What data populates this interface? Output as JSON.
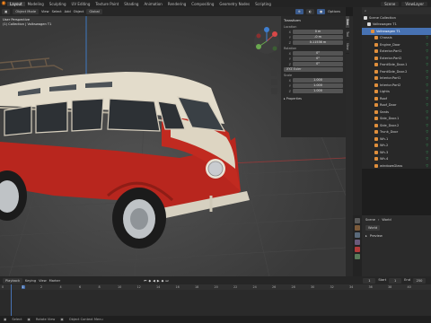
{
  "topbar": {
    "workspaces": [
      "Layout",
      "Modeling",
      "Sculpting",
      "UV Editing",
      "Texture Paint",
      "Shading",
      "Animation",
      "Rendering",
      "Compositing",
      "Geometry Nodes",
      "Scripting"
    ],
    "active_workspace": "Layout",
    "scene": "Scene",
    "view_layer": "ViewLayer"
  },
  "viewport_header": {
    "mode": "Object Mode",
    "view": "View",
    "select": "Select",
    "add": "Add",
    "object": "Object",
    "orientation": "Global",
    "options": "Options"
  },
  "viewport_info": {
    "line1": "User Perspective",
    "line2": "(1) Collection | Volkswagen T1"
  },
  "npanel": {
    "title": "Transform",
    "location_label": "Location",
    "location": [
      {
        "axis": "X",
        "value": "0 m"
      },
      {
        "axis": "Y",
        "value": "-0 m"
      },
      {
        "axis": "Z",
        "value": "0.11536 m"
      }
    ],
    "rotation_label": "Rotation",
    "rotation": [
      {
        "axis": "X",
        "value": "0°"
      },
      {
        "axis": "Y",
        "value": "0°"
      },
      {
        "axis": "Z",
        "value": "0°"
      }
    ],
    "rotation_mode": "XYZ Euler",
    "scale_label": "Scale",
    "scale": [
      {
        "axis": "X",
        "value": "1.000"
      },
      {
        "axis": "Y",
        "value": "1.000"
      },
      {
        "axis": "Z",
        "value": "1.000"
      }
    ],
    "properties_label": "Properties",
    "tabs": [
      "Item",
      "Tool",
      "View"
    ]
  },
  "outliner": {
    "title": "Scene Collection",
    "items": [
      {
        "label": "Scene Collection",
        "indent": 0,
        "color": "#d9d9d9",
        "selected": false
      },
      {
        "label": "Volkswagen T1",
        "indent": 1,
        "color": "#d9d9d9",
        "selected": false
      },
      {
        "label": "Volkswagen T1",
        "indent": 2,
        "color": "#e08f3c",
        "selected": true
      },
      {
        "label": "Chassis",
        "indent": 3,
        "color": "#e08f3c",
        "selected": false
      },
      {
        "label": "Engine_Door",
        "indent": 3,
        "color": "#e08f3c",
        "selected": false
      },
      {
        "label": "Exterior.Part1",
        "indent": 3,
        "color": "#e08f3c",
        "selected": false
      },
      {
        "label": "Exterior.Part2",
        "indent": 3,
        "color": "#e08f3c",
        "selected": false
      },
      {
        "label": "FrontSide_Door.1",
        "indent": 3,
        "color": "#e08f3c",
        "selected": false
      },
      {
        "label": "FrontSide_Door.2",
        "indent": 3,
        "color": "#e08f3c",
        "selected": false
      },
      {
        "label": "Interior.Part1",
        "indent": 3,
        "color": "#e08f3c",
        "selected": false
      },
      {
        "label": "Interior.Part2",
        "indent": 3,
        "color": "#e08f3c",
        "selected": false
      },
      {
        "label": "Lights",
        "indent": 3,
        "color": "#e08f3c",
        "selected": false
      },
      {
        "label": "Roof",
        "indent": 3,
        "color": "#e08f3c",
        "selected": false
      },
      {
        "label": "Roof_Door",
        "indent": 3,
        "color": "#e08f3c",
        "selected": false
      },
      {
        "label": "Seats",
        "indent": 3,
        "color": "#e08f3c",
        "selected": false
      },
      {
        "label": "Side_Door.1",
        "indent": 3,
        "color": "#e08f3c",
        "selected": false
      },
      {
        "label": "Side_Door.2",
        "indent": 3,
        "color": "#e08f3c",
        "selected": false
      },
      {
        "label": "Trunk_Door",
        "indent": 3,
        "color": "#e08f3c",
        "selected": false
      },
      {
        "label": "Wh.1",
        "indent": 3,
        "color": "#e08f3c",
        "selected": false
      },
      {
        "label": "Wh.2",
        "indent": 3,
        "color": "#e08f3c",
        "selected": false
      },
      {
        "label": "Wh.3",
        "indent": 3,
        "color": "#e08f3c",
        "selected": false
      },
      {
        "label": "Wh.4",
        "indent": 3,
        "color": "#e08f3c",
        "selected": false
      },
      {
        "label": "windowsGlass",
        "indent": 3,
        "color": "#e08f3c",
        "selected": false
      },
      {
        "label": "Scene",
        "indent": 1,
        "color": "#9a9a9a",
        "selected": false
      }
    ]
  },
  "properties": {
    "scene": "Scene",
    "world_breadcrumb": "World",
    "world": "World",
    "section": "Preview"
  },
  "timeline_header": {
    "playback": "Playback",
    "keying": "Keying",
    "view": "View",
    "marker": "Marker",
    "current_frame": "1",
    "start_label": "Start",
    "start": "1",
    "end_label": "End",
    "end": "250"
  },
  "timeline": {
    "ticks": [
      "0",
      "1",
      "2",
      "4",
      "6",
      "8",
      "10",
      "12",
      "14",
      "16",
      "18",
      "20",
      "22",
      "24",
      "26",
      "28",
      "30",
      "32",
      "34",
      "36",
      "38",
      "40"
    ],
    "current": "1"
  },
  "statusbar": {
    "select": "Select",
    "rotate": "Rotate View",
    "context": "Object Context Menu"
  },
  "colors": {
    "accent": "#4772b3",
    "object_orange": "#e08f3c",
    "bus_red": "#c2271f",
    "bus_cream": "#e7e1d2"
  }
}
